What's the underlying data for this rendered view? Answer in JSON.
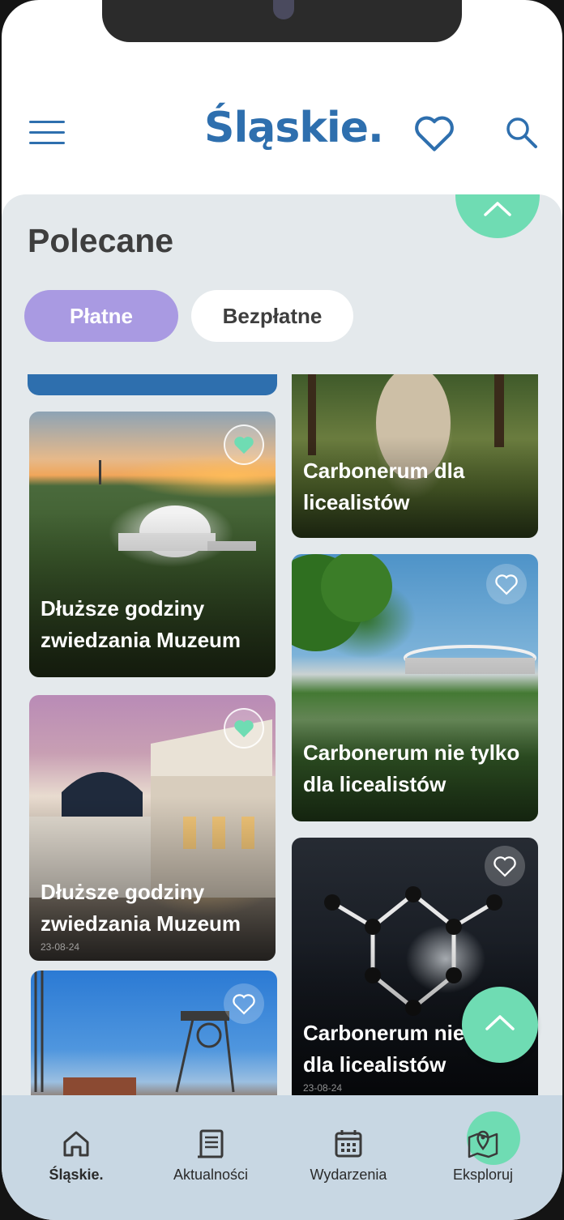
{
  "header": {
    "logo": "Śląskie.",
    "menu_icon": "hamburger-menu-icon",
    "favorites_icon": "heart-icon",
    "search_icon": "search-icon"
  },
  "section": {
    "title": "Polecane"
  },
  "filters": {
    "paid": "Płatne",
    "free": "Bezpłatne",
    "active": "paid"
  },
  "cards": [
    {
      "title": "Dłuższe godziny zwiedzania Muzeum",
      "favorited": true,
      "image": "planetarium-sunset"
    },
    {
      "title": "Carbonerum dla licealistów",
      "image": "forest-sculpture"
    },
    {
      "title": "Carbonerum nie tylko dla licealistów",
      "favorited": false,
      "image": "stadium-lake"
    },
    {
      "title": "Dłuższe godziny zwiedzania Muzeum",
      "date": "23-08-24",
      "favorited": true,
      "image": "opera-building"
    },
    {
      "title": "Carbonerum nie tylko dla licealistów",
      "date": "23-08-24",
      "favorited": false,
      "image": "molecule-sculpture"
    },
    {
      "title": "",
      "favorited": false,
      "image": "mine-shaft-tower"
    }
  ],
  "bottom_nav": [
    {
      "label": "Śląskie.",
      "icon": "home-icon",
      "active": true
    },
    {
      "label": "Aktualności",
      "icon": "news-icon",
      "active": false
    },
    {
      "label": "Wydarzenia",
      "icon": "calendar-icon",
      "active": false
    },
    {
      "label": "Eksploruj",
      "icon": "map-pin-icon",
      "active": false
    }
  ],
  "colors": {
    "brand_blue": "#2e6fae",
    "accent_green": "#6fdcb3",
    "chip_purple": "#a99ae2",
    "panel_bg": "#e4e9ec",
    "nav_bg": "#c8d7e3"
  }
}
